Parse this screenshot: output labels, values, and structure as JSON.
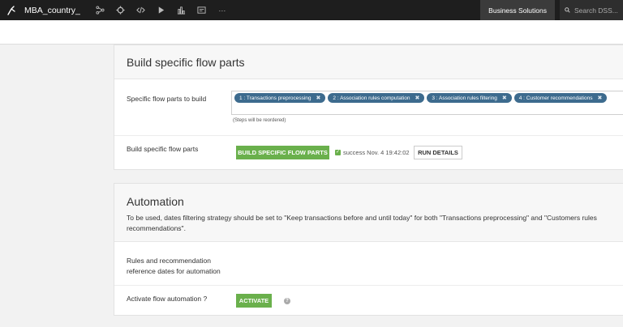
{
  "topbar": {
    "project_name": "MBA_country_",
    "icons": [
      "flow-icon",
      "recipe-icon",
      "code-icon",
      "run-icon",
      "dashboard-icon",
      "wiki-icon",
      "more-icon"
    ],
    "more_label": "···",
    "business_solutions_label": "Business Solutions",
    "search_placeholder": "Search DSS..."
  },
  "build_section": {
    "title": "Build specific flow parts",
    "parts_label": "Specific flow parts to build",
    "tags": [
      "1 : Transactions preprocessing",
      "2 : Association rules computation",
      "3 : Association rules filtering",
      "4 : Customer recommendations"
    ],
    "tag_remove_symbol": "✖",
    "hint": "(Steps will be reordered)",
    "build_label": "Build specific flow parts",
    "build_button": "BUILD SPECIFIC FLOW PARTS",
    "status_text": "success Nov. 4 19:42:02",
    "run_details_button": "RUN DETAILS"
  },
  "automation_section": {
    "title": "Automation",
    "description": "To be used, dates filtering strategy should be set to \"Keep transactions before and until today\" for both \"Transactions preprocessing\" and \"Customers rules recommendations\".",
    "dates_label_line1": "Rules and recommendation",
    "dates_label_line2": "reference dates for automation",
    "activate_label": "Activate flow automation ?",
    "activate_button": "ACTIVATE",
    "help_symbol": "?"
  },
  "colors": {
    "topbar": "#1e1e1e",
    "tag": "#3d6b8e",
    "green_button": "#6ab04c"
  }
}
